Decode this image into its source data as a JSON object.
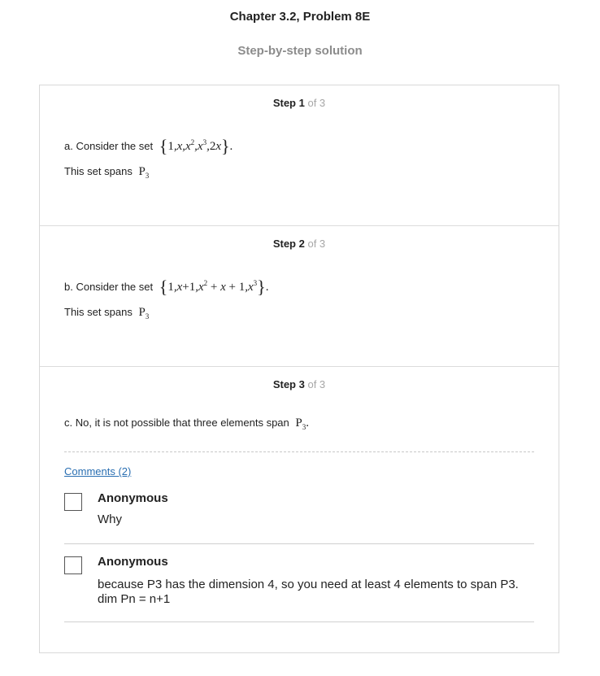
{
  "header": {
    "title": "Chapter 3.2, Problem 8E",
    "subtitle": "Step-by-step solution"
  },
  "steps": [
    {
      "step_label": "Step 1",
      "of_label": "of 3",
      "line1_text": "a. Consider the set",
      "line2_text": "This set spans"
    },
    {
      "step_label": "Step 2",
      "of_label": "of 3",
      "line1_text": "b. Consider the set",
      "line2_text": "This set spans"
    },
    {
      "step_label": "Step 3",
      "of_label": "of 3",
      "line1_text": "c. No, it is not possible that three elements span"
    }
  ],
  "comments": {
    "link_label": "Comments (2)",
    "items": [
      {
        "author": "Anonymous",
        "text": "Why"
      },
      {
        "author": "Anonymous",
        "text": "because P3 has the dimension 4, so you need at least 4 elements to span P3. dim Pn = n+1"
      }
    ]
  }
}
